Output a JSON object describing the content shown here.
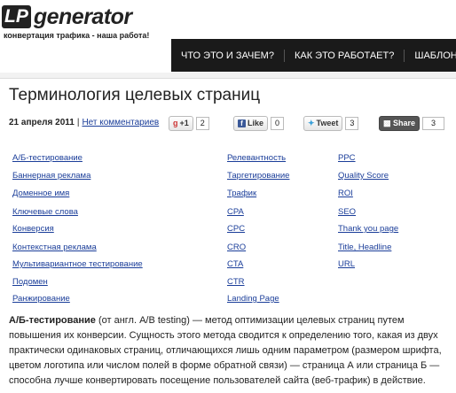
{
  "logo": {
    "lp": "LP",
    "name": "generator",
    "tagline": "конвертация трафика - наша работа!"
  },
  "nav": [
    "ЧТО ЭТО И ЗАЧЕМ?",
    "КАК ЭТО РАБОТАЕТ?",
    "ШАБЛОНЫ"
  ],
  "article": {
    "title": "Терминология целевых страниц",
    "date": "21 апреля 2011",
    "separator": "|",
    "comments": "Нет комментариев"
  },
  "share": {
    "google": {
      "icon": "g",
      "label": "+1",
      "count": "2"
    },
    "facebook": {
      "icon": "f",
      "label": "Like",
      "count": "0"
    },
    "twitter": {
      "icon": "bird-icon",
      "label": "Tweet",
      "count": "3"
    },
    "share": {
      "label": "Share",
      "count": "3"
    }
  },
  "terms": {
    "col1": [
      "А/Б-тестирование",
      "Баннерная реклама",
      "Доменное имя",
      "Ключевые слова",
      "Конверсия",
      "Контекстная реклама",
      "Мультивариантное тестирование",
      "Подомен",
      "Ранжирование"
    ],
    "col2": [
      "Релевантность",
      "Таргетирование",
      "Трафик",
      "CPA",
      "CPC",
      "CRO",
      "CTA",
      "CTR",
      "Landing Page"
    ],
    "col3": [
      "PPC",
      "Quality Score",
      "ROI",
      "SEO",
      "Thank you page",
      "Title, Headline",
      "URL"
    ]
  },
  "definition": {
    "term": "А/Б-тестирование",
    "text": " (от англ. A/B testing) — метод оптимизации целевых страниц путем повышения их конверсии. Сущность этого метода сводится к определению того, какая из двух практически одинаковых страниц, отличающихся лишь одним параметром (размером шрифта, цветом логотипа или числом полей в форме обратной связи) — страница А или страница Б — способна лучше конвертировать посещение пользователей сайта (веб-трафик) в действие."
  }
}
